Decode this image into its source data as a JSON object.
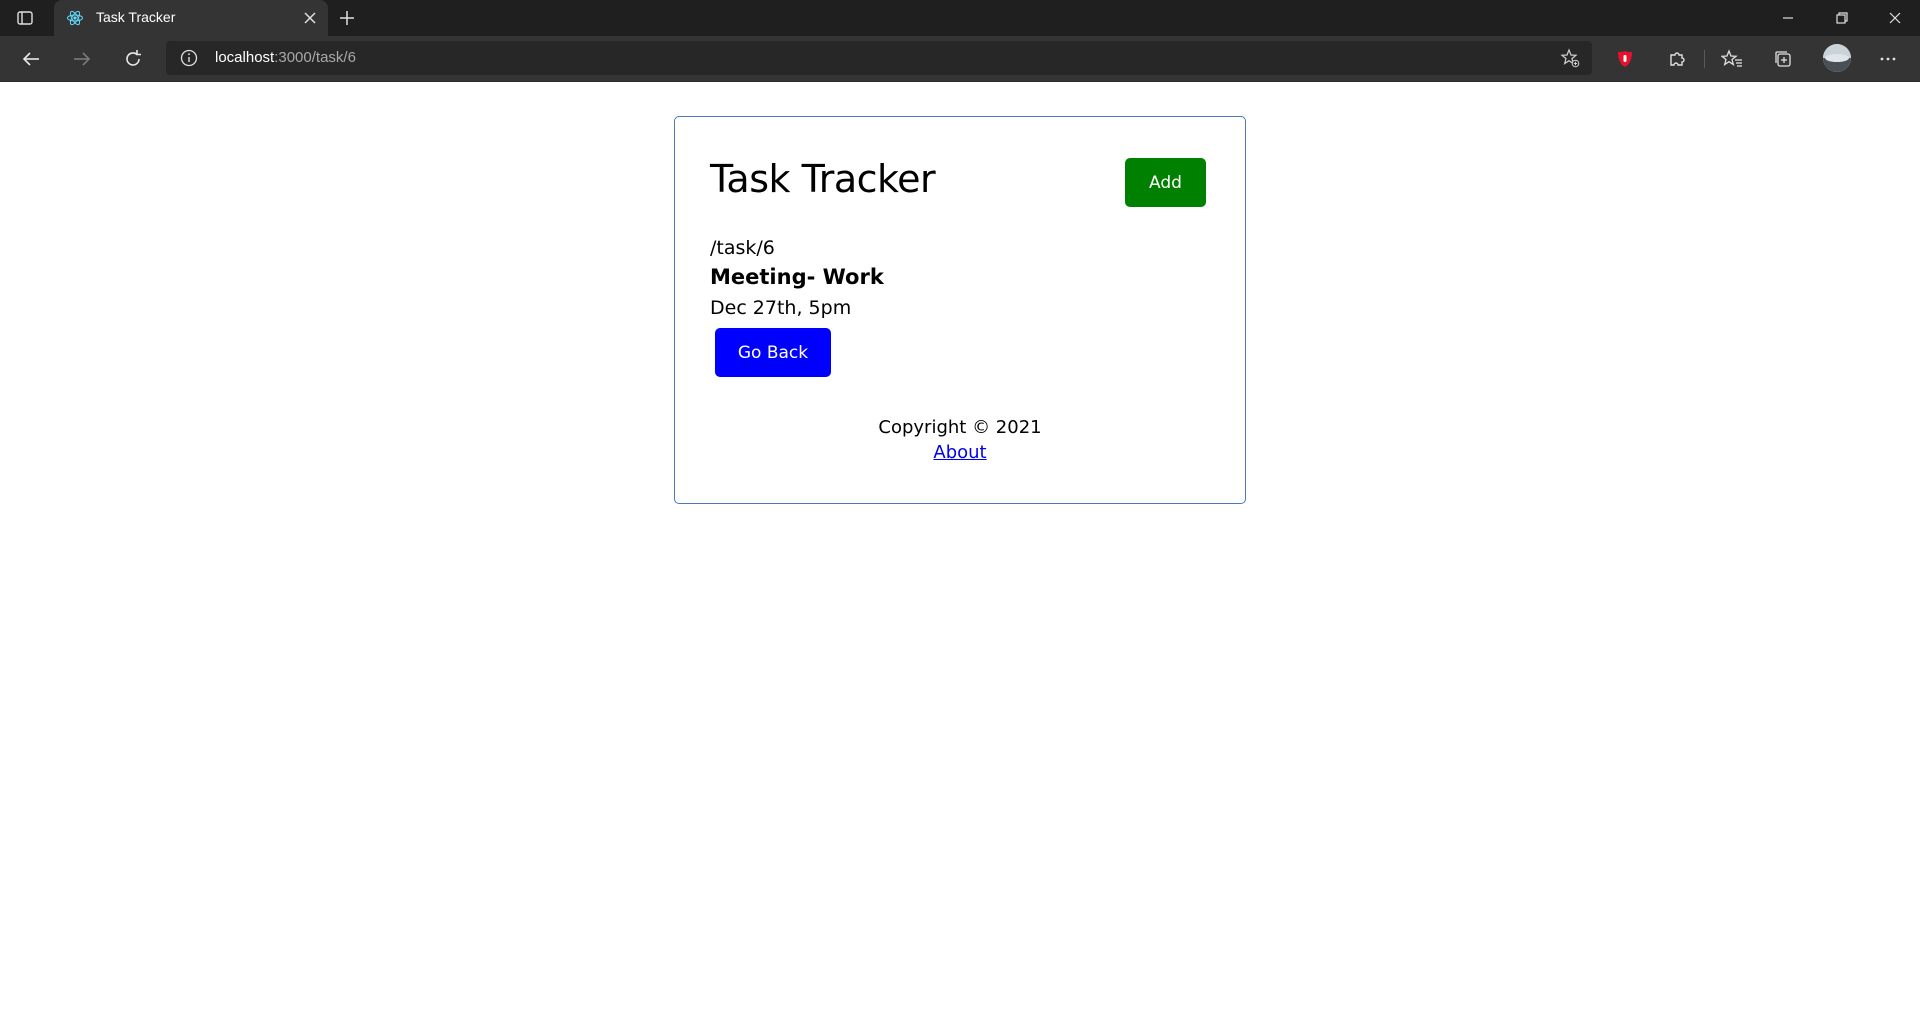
{
  "browser": {
    "tab_title": "Task Tracker",
    "url_host": "localhost",
    "url_rest": ":3000/task/6"
  },
  "app": {
    "title": "Task Tracker",
    "add_button_label": "Add",
    "add_button_color": "#008000"
  },
  "task": {
    "path": "/task/6",
    "text": "Meeting- Work",
    "day": "Dec 27th, 5pm",
    "back_button_label": "Go Back",
    "back_button_color": "#0000ff"
  },
  "footer": {
    "copyright": "Copyright © 2021",
    "about_link": "About"
  },
  "icons": {
    "tab_actions": "tab-actions-icon",
    "favicon": "react-icon",
    "close": "close-icon",
    "new_tab": "plus-icon",
    "back": "arrow-left-icon",
    "forward": "arrow-right-icon",
    "refresh": "refresh-icon",
    "info": "info-icon",
    "add_favorite": "star-add-icon",
    "extension_red": "shield-icon",
    "extensions": "puzzle-icon",
    "favorites": "favorites-icon",
    "collections": "collections-icon",
    "profile": "avatar",
    "menu": "more-icon"
  }
}
